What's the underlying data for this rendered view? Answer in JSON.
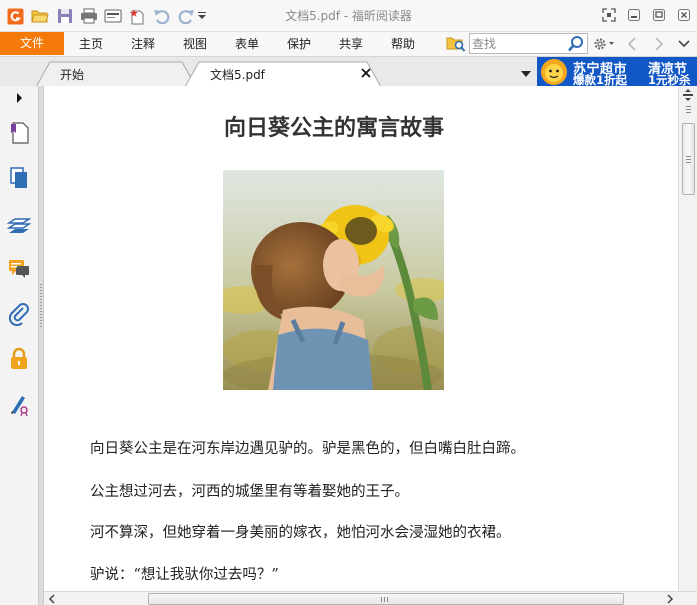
{
  "window": {
    "title": "文档5.pdf - 福昕阅读器"
  },
  "menu": {
    "file": "文件",
    "items": [
      "主页",
      "注释",
      "视图",
      "表单",
      "保护",
      "共享",
      "帮助"
    ]
  },
  "search": {
    "placeholder": "查找"
  },
  "tabs": [
    {
      "label": "开始"
    },
    {
      "label": "文档5.pdf"
    }
  ],
  "ad": {
    "line1": "苏宁超市",
    "line1b": "清凉节",
    "line2": "爆款1折起",
    "line2b": "1元秒杀"
  },
  "document": {
    "title": "向日葵公主的寓言故事",
    "paragraphs": [
      "向日葵公主是在河东岸边遇见驴的。驴是黑色的，但白嘴白肚白蹄。",
      "公主想过河去，河西的城堡里有等着娶她的王子。",
      "河不算深，但她穿着一身美丽的嫁衣，她怕河水会浸湿她的衣裙。",
      "驴说：“想让我驮你过去吗？”"
    ]
  },
  "colors": {
    "file_menu": "#f47a0a",
    "ad_background": "#1257c6",
    "icon_blue": "#2f6db5",
    "lock_orange": "#f2a31e"
  }
}
